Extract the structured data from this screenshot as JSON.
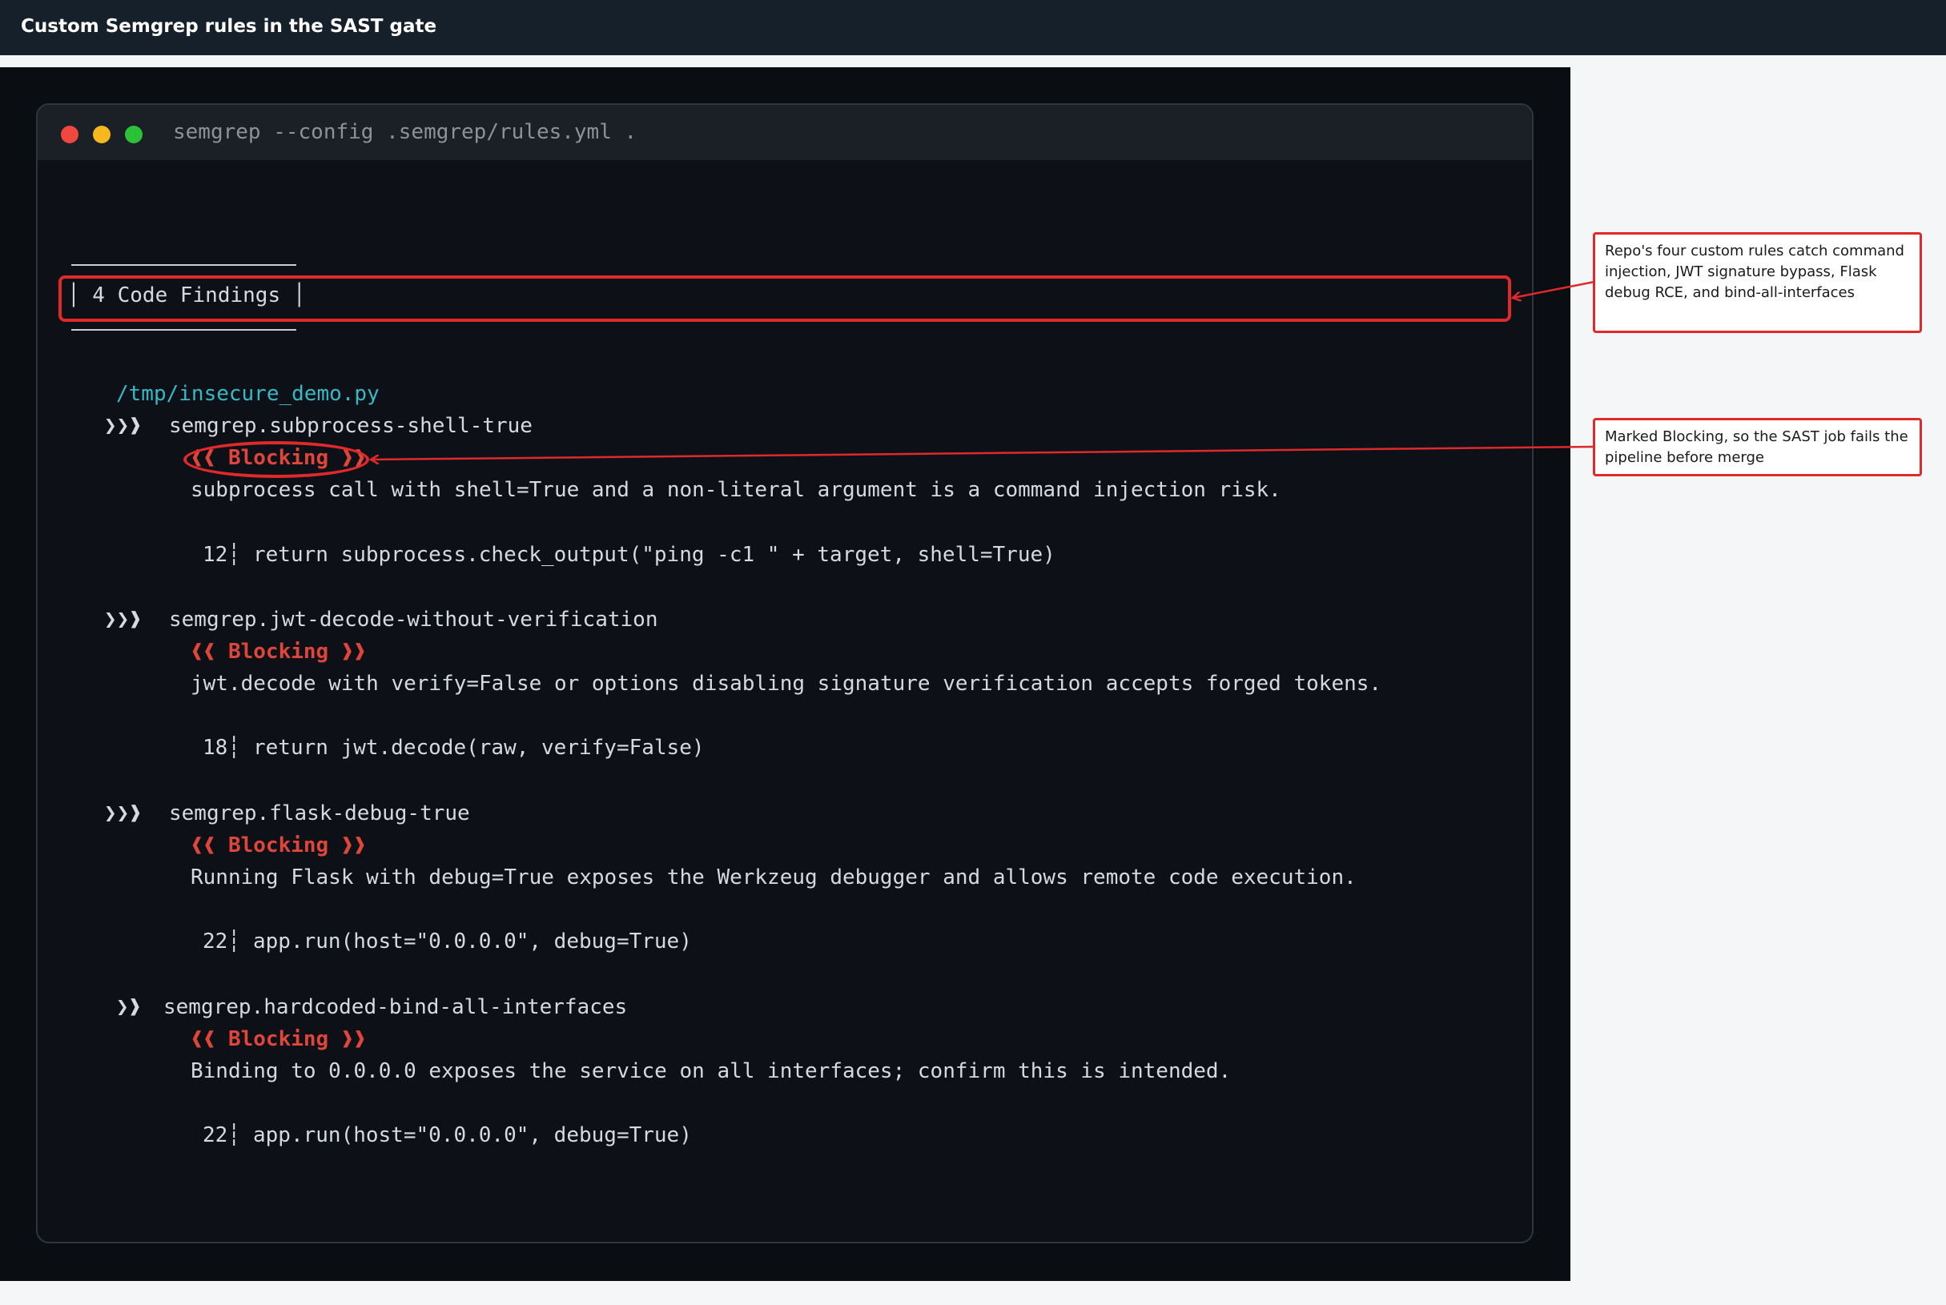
{
  "header": {
    "title": "Custom Semgrep rules in the SAST gate"
  },
  "terminal": {
    "command": "semgrep --config .semgrep/rules.yml .",
    "summary": "│ 4 Code Findings │",
    "file": "/tmp/insecure_demo.py",
    "findings": [
      {
        "chevrons": "❯❯❱",
        "rule": "semgrep.subprocess-shell-true",
        "badge": "❰❰ Blocking ❱❱",
        "message": "subprocess call with shell=True and a non-literal argument is a command injection risk.",
        "line_no": "12┆",
        "code": "return subprocess.check_output(\"ping -c1 \" + target, shell=True)"
      },
      {
        "chevrons": "❯❯❱",
        "rule": "semgrep.jwt-decode-without-verification",
        "badge": "❰❰ Blocking ❱❱",
        "message": "jwt.decode with verify=False or options disabling signature verification accepts forged tokens.",
        "line_no": "18┆",
        "code": "return jwt.decode(raw, verify=False)"
      },
      {
        "chevrons": "❯❯❱",
        "rule": "semgrep.flask-debug-true",
        "badge": "❰❰ Blocking ❱❱",
        "message": "Running Flask with debug=True exposes the Werkzeug debugger and allows remote code execution.",
        "line_no": "22┆",
        "code": "app.run(host=\"0.0.0.0\", debug=True)"
      },
      {
        "chevrons": "❯❱",
        "rule": "semgrep.hardcoded-bind-all-interfaces",
        "badge": "❰❰ Blocking ❱❱",
        "message": "Binding to 0.0.0.0 exposes the service on all interfaces; confirm this is intended.",
        "line_no": "22┆",
        "code": "app.run(host=\"0.0.0.0\", debug=True)"
      }
    ]
  },
  "annotations": [
    {
      "text": "Repo's four custom rules catch command injection, JWT signature bypass, Flask debug RCE, and bind-all-interfaces"
    },
    {
      "text": "Marked Blocking, so the SAST job fails the pipeline before merge"
    }
  ],
  "colors": {
    "accent_red": "#e0292b",
    "badge_red": "#e0453a",
    "path_cyan": "#37b8c4",
    "terminal_bg": "#0d1117"
  }
}
